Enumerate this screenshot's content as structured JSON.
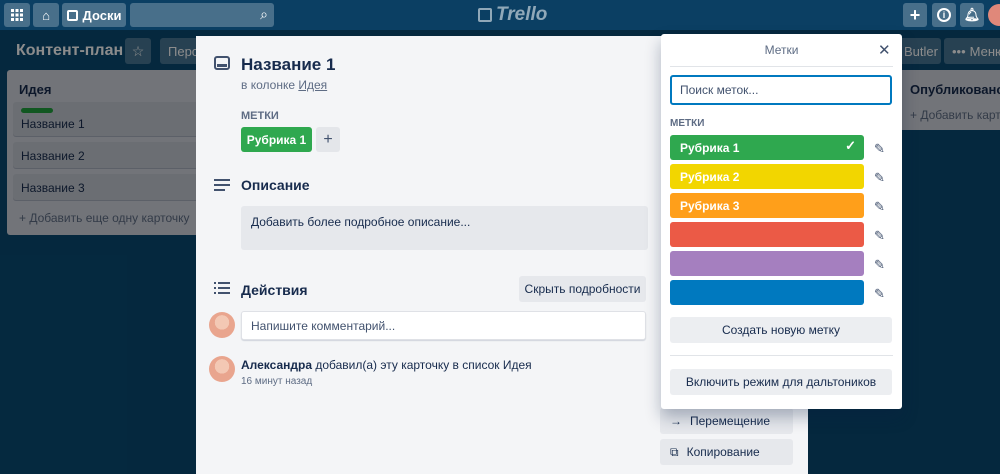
{
  "topbar": {
    "boards_label": "Доски",
    "logo": "Trello"
  },
  "board": {
    "title": "Контент-план",
    "header_buttons": [
      "Перс",
      "Butler",
      "Меню"
    ]
  },
  "lists": [
    {
      "title": "Идея",
      "cards": [
        "Название 1",
        "Название 2",
        "Название 3"
      ],
      "add_label": "+ Добавить еще одну карточку"
    },
    {
      "title": "Опубликовано",
      "add_label": "+ Добавить карт"
    }
  ],
  "card_modal": {
    "title": "Название 1",
    "list_prefix": "в колонке",
    "list_name": "Идея",
    "labels_heading": "Метки",
    "label_chip": "Рубрика 1",
    "add_label_symbol": "+",
    "description_heading": "Описание",
    "description_placeholder": "Добавить более подробное описание...",
    "activity_heading": "Действия",
    "hide_details": "Скрыть подробности",
    "comment_placeholder": "Напишите комментарий...",
    "activity": {
      "user": "Александра",
      "text": "добавил(а) эту карточку в список Идея",
      "time": "16 минут назад"
    },
    "side_actions": [
      "Перемещение",
      "Копирование"
    ]
  },
  "labels_popover": {
    "title": "Метки",
    "search_placeholder": "Поиск меток...",
    "heading": "Метки",
    "labels": [
      {
        "name": "Рубрика 1",
        "color": "#2fa84f",
        "checked": true
      },
      {
        "name": "Рубрика 2",
        "color": "#f2d600",
        "checked": false
      },
      {
        "name": "Рубрика 3",
        "color": "#ff9f1a",
        "checked": false
      },
      {
        "name": "",
        "color": "#eb5a46",
        "checked": false
      },
      {
        "name": "",
        "color": "#a57fbf",
        "checked": false
      },
      {
        "name": "",
        "color": "#0079bf",
        "checked": false
      }
    ],
    "create_button": "Создать новую метку",
    "colorblind_button": "Включить режим для дальтоников"
  }
}
